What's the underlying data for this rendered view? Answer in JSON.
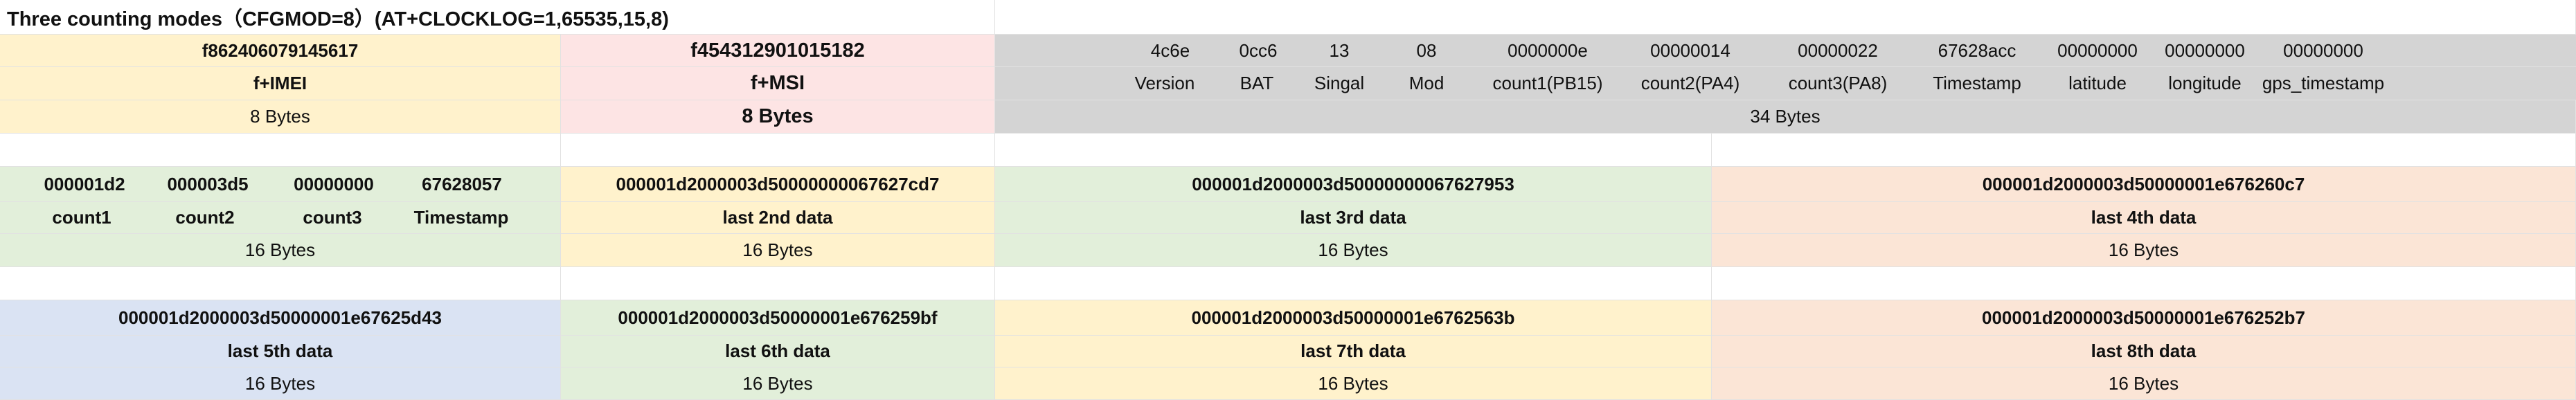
{
  "title": "Three counting modes（CFGMOD=8）(AT+CLOCKLOG=1,65535,15,8)",
  "section1": {
    "imei_value": "f862406079145617",
    "imei_label": "f+IMEI",
    "imei_size": "8 Bytes",
    "msi_value": "f454312901015182",
    "msi_label": "f+MSI",
    "msi_size": "8 Bytes",
    "payload_values": [
      "4c6e",
      "0cc6",
      "13",
      "08",
      "0000000e",
      "00000014",
      "00000022",
      "67628acc",
      "00000000",
      "00000000",
      "00000000"
    ],
    "payload_labels": [
      "Version",
      "BAT",
      "Singal",
      "Mod",
      "count1(PB15)",
      "count2(PA4)",
      "count3(PA8)",
      "Timestamp",
      "latitude",
      "longitude",
      "gps_timestamp"
    ],
    "payload_size": "34 Bytes"
  },
  "section2": {
    "first_values": [
      "000001d2",
      "000003d5",
      "00000000",
      "67628057"
    ],
    "first_labels": [
      "count1",
      "count2",
      "count3",
      "Timestamp"
    ],
    "first_size": "16 Bytes",
    "blocks": [
      {
        "value": "000001d2000003d50000000067627cd7",
        "label": "last 2nd data",
        "size": "16 Bytes"
      },
      {
        "value": "000001d2000003d50000000067627953",
        "label": "last 3rd data",
        "size": "16 Bytes"
      },
      {
        "value": "000001d2000003d50000001e676260c7",
        "label": "last 4th data",
        "size": "16 Bytes"
      }
    ]
  },
  "section3": {
    "blocks": [
      {
        "value": "000001d2000003d50000001e67625d43",
        "label": "last 5th data",
        "size": "16 Bytes"
      },
      {
        "value": "000001d2000003d50000001e676259bf",
        "label": "last 6th data",
        "size": "16 Bytes"
      },
      {
        "value": "000001d2000003d50000001e6762563b",
        "label": "last 7th data",
        "size": "16 Bytes"
      },
      {
        "value": "000001d2000003d50000001e676252b7",
        "label": "last 8th data",
        "size": "16 Bytes"
      }
    ]
  },
  "colors": {
    "yellow": "#fff2cc",
    "pink": "#fde4e4",
    "gray": "#d4d4d4",
    "green": "#e2efda",
    "orange": "#fbe5d6",
    "blue": "#dae3f3"
  }
}
